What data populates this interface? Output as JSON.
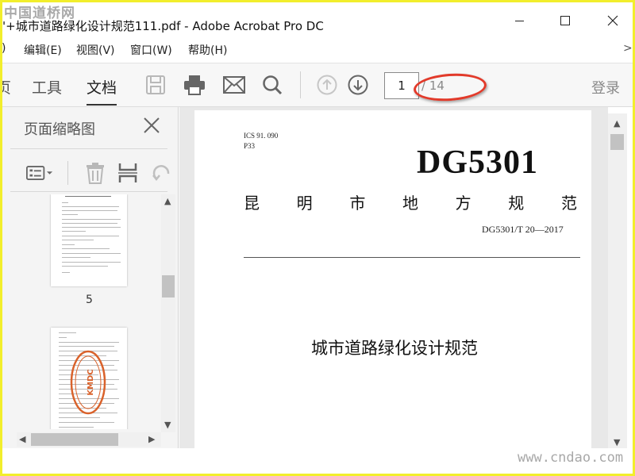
{
  "watermark_top": "中国道桥网",
  "watermark_bottom": "www.cndao.com",
  "window": {
    "title": "'+城市道路绿化设计规范111.pdf - Adobe Acrobat Pro DC",
    "minimize_icon": "minimize-icon",
    "maximize_icon": "maximize-icon",
    "close_icon": "close-icon"
  },
  "menu": [
    {
      "label": ")"
    },
    {
      "label": "编辑(E)"
    },
    {
      "label": "视图(V)"
    },
    {
      "label": "窗口(W)"
    },
    {
      "label": "帮助(H)"
    },
    {
      "label": ">"
    }
  ],
  "toolbar": {
    "tabs": [
      {
        "label": "页"
      },
      {
        "label": "工具"
      },
      {
        "label": "文档",
        "active": true
      }
    ],
    "icons": [
      "save-icon",
      "print-icon",
      "email-icon",
      "search-icon",
      "previous-page-icon",
      "next-page-icon"
    ],
    "page_current": "1",
    "page_total": "/ 14",
    "signin": "登录"
  },
  "panel": {
    "title": "页面缩略图",
    "tools": [
      "thumbnail-options-icon",
      "delete-page-icon",
      "extract-page-icon",
      "rotate-page-icon"
    ],
    "thumbnails": [
      {
        "label": "5"
      },
      {
        "label": ""
      }
    ],
    "stamp_text": "KMDC"
  },
  "document": {
    "ics": "ICS 91. 090",
    "classification": "P33",
    "code": "DG5301",
    "standard_chars": [
      "昆",
      "明",
      "市",
      "地",
      "方",
      "规",
      "范"
    ],
    "number": "DG5301/T 20—2017",
    "title": "城市道路绿化设计规范"
  },
  "colors": {
    "frame": "#f2ee2c",
    "highlight_oval": "#e23a2a",
    "stamp": "#d9622b"
  }
}
